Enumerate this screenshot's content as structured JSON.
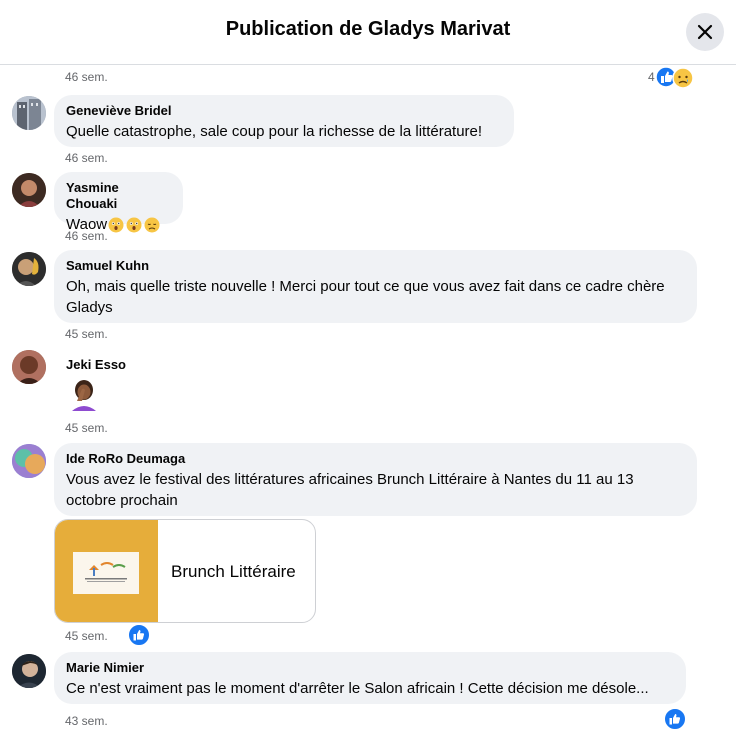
{
  "header": {
    "title": "Publication de Gladys Marivat"
  },
  "top_meta": {
    "time": "46 sem.",
    "reaction_count": "4"
  },
  "comments": [
    {
      "author": "Geneviève Bridel",
      "text": "Quelle catastrophe, sale coup pour la richesse de la littérature!",
      "time": "46 sem."
    },
    {
      "author": "Yasmine Chouaki",
      "text": "Waow",
      "time": "46 sem."
    },
    {
      "author": "Samuel Kuhn",
      "text": "Oh, mais quelle triste nouvelle ! Merci pour tout ce que vous avez fait dans ce cadre chère Gladys",
      "time": "45 sem."
    },
    {
      "author": "Jeki Esso",
      "text": "",
      "time": "45 sem."
    },
    {
      "author": "Ide RoRo Deumaga",
      "text": "Vous avez le festival des littératures africaines Brunch Littéraire à Nantes du 11 au 13 octobre prochain",
      "time": "45 sem.",
      "link_title": "Brunch Littéraire"
    },
    {
      "author": "Marie Nimier",
      "text": "Ce n'est vraiment pas le moment d'arrêter le Salon africain ! Cette décision me désole...",
      "time": "43 sem."
    }
  ],
  "colors": {
    "like_blue": "#1877f2",
    "bubble_bg": "#f0f2f5",
    "meta_gray": "#65676b"
  },
  "icons": [
    "close-icon",
    "like-icon",
    "sad-emoji-icon",
    "astonished-emoji-icon",
    "disappointed-emoji-icon",
    "facepalm-emoji-icon"
  ]
}
